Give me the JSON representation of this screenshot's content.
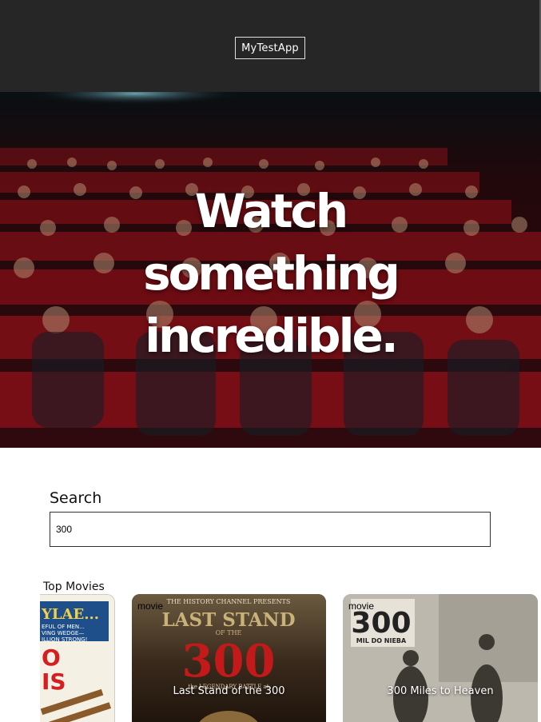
{
  "header": {
    "brand": "MyTestApp"
  },
  "hero": {
    "title_lines": [
      "Watch",
      "something",
      "incredible."
    ]
  },
  "search": {
    "label": "Search",
    "value": "300"
  },
  "top_movies": {
    "title": "Top Movies",
    "cards": [
      {
        "type": "",
        "name": "",
        "poster_text": [
          "YLAE...",
          "EFUL OF MEN...",
          "VING WEDGE—",
          "ILLION STRONG!",
          "O",
          "IS"
        ]
      },
      {
        "type": "movie",
        "name": "Last Stand of the 300",
        "poster_text": [
          "THE HISTORY CHANNEL PRESENTS",
          "LAST STAND",
          "OF THE",
          "300",
          "the LEGENDARY BATTLE at"
        ]
      },
      {
        "type": "movie",
        "name": "300 Miles to Heaven",
        "poster_text": [
          "300",
          "MIL DO NIEBA"
        ]
      }
    ]
  },
  "colors": {
    "header_bg": "#262626",
    "hero_seat": "#b3161f",
    "card2_red": "#c21a1a"
  }
}
